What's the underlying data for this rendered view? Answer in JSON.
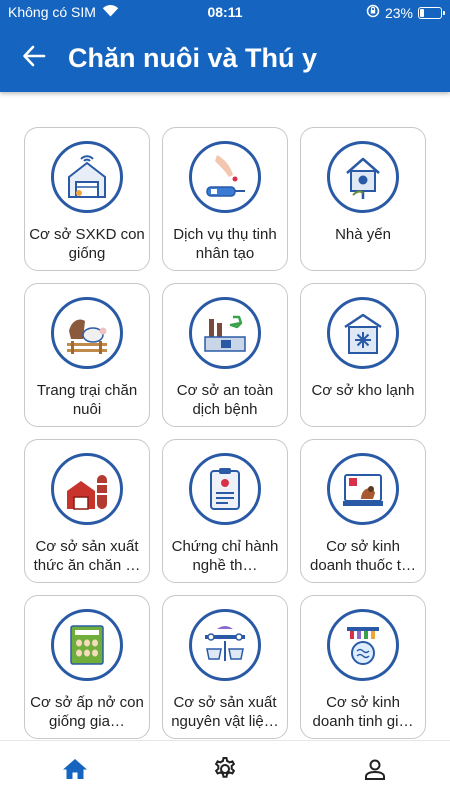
{
  "status_bar": {
    "carrier": "Không có SIM",
    "time": "08:11",
    "battery_percent": "23%",
    "battery_level": 0.23,
    "icons": [
      "wifi-icon",
      "orientation-lock-icon",
      "battery-icon"
    ]
  },
  "header": {
    "title": "Chăn nuôi và Thú y",
    "back_icon": "arrow-left-icon",
    "background_color": "#1565c0"
  },
  "grid": {
    "items": [
      {
        "label": "Cơ sở SXKD con giống",
        "icon": "barn-chicken-icon"
      },
      {
        "label": "Dịch vụ thụ tinh nhân tạo",
        "icon": "insemination-icon"
      },
      {
        "label": "Nhà yến",
        "icon": "bird-house-icon"
      },
      {
        "label": "Trang trại chăn nuôi",
        "icon": "farm-animals-icon"
      },
      {
        "label": "Cơ sở an toàn dịch bệnh",
        "icon": "safe-factory-icon"
      },
      {
        "label": "Cơ sở kho lạnh",
        "icon": "cold-storage-icon"
      },
      {
        "label": "Cơ sở sản xuất thức ăn chăn …",
        "icon": "feed-mill-icon"
      },
      {
        "label": "Chứng chỉ hành nghề th…",
        "icon": "certificate-icon"
      },
      {
        "label": "Cơ sở kinh doanh thuốc t…",
        "icon": "vet-medicine-icon"
      },
      {
        "label": "Cơ sở ấp nở con giống gia…",
        "icon": "egg-incubator-icon"
      },
      {
        "label": "Cơ sở sản xuất nguyên vật liệ…",
        "icon": "conveyor-production-icon"
      },
      {
        "label": "Cơ sở kinh doanh tinh gi…",
        "icon": "semen-lab-icon"
      }
    ],
    "circle_color": "#2a5aa5"
  },
  "bottom_nav": {
    "items": [
      {
        "icon": "home-icon",
        "active": true
      },
      {
        "icon": "settings-gear-icon",
        "active": false
      },
      {
        "icon": "user-profile-icon",
        "active": false
      }
    ],
    "active_color": "#1565c0"
  }
}
